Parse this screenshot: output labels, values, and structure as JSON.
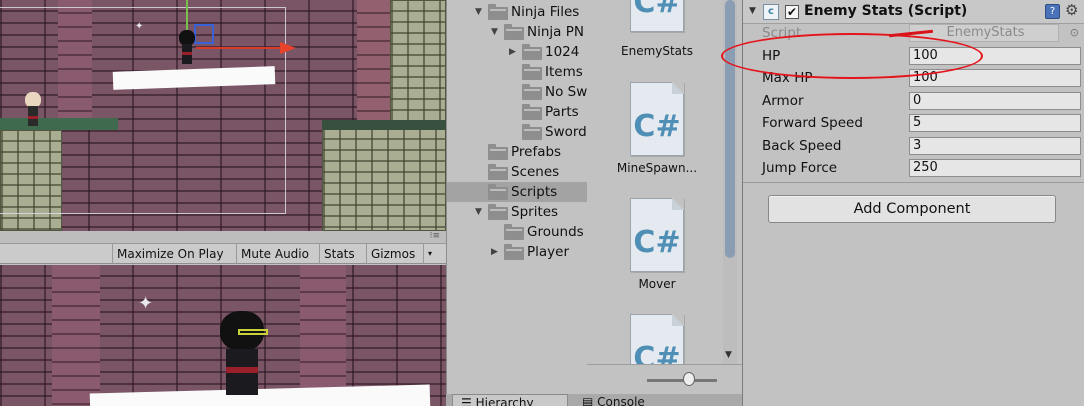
{
  "scene_view": {},
  "game_view": {
    "toolbar": {
      "maximize_label": "Maximize On Play",
      "mute_label": "Mute Audio",
      "stats_label": "Stats",
      "gizmos_label": "Gizmos"
    }
  },
  "project": {
    "tree": [
      {
        "label": "Ninja Files",
        "depth": 1,
        "expanded": true
      },
      {
        "label": "Ninja PN",
        "depth": 2,
        "expanded": true
      },
      {
        "label": "1024",
        "depth": 3,
        "expanded": false
      },
      {
        "label": "Items",
        "depth": 4
      },
      {
        "label": "No Sw",
        "depth": 4
      },
      {
        "label": "Parts",
        "depth": 4
      },
      {
        "label": "Sword",
        "depth": 4
      },
      {
        "label": "Prefabs",
        "depth": 1
      },
      {
        "label": "Scenes",
        "depth": 1
      },
      {
        "label": "Scripts",
        "depth": 1,
        "selected": true
      },
      {
        "label": "Sprites",
        "depth": 1,
        "expanded": true
      },
      {
        "label": "Grounds",
        "depth": 2
      },
      {
        "label": "Player",
        "depth": 2,
        "expanded": false
      }
    ],
    "assets": [
      {
        "name": "EnemyStats",
        "icon": "csharp-script-icon"
      },
      {
        "name": "MineSpawn...",
        "icon": "csharp-script-icon"
      },
      {
        "name": "Mover",
        "icon": "csharp-script-icon"
      },
      {
        "name": "",
        "icon": "csharp-script-icon"
      }
    ],
    "script_glyph": "C#",
    "bottom_tabs": {
      "hierarchy": "Hierarchy",
      "console": "Console"
    }
  },
  "inspector": {
    "component_title": "Enemy Stats (Script)",
    "enabled_mark": "✔",
    "fields": [
      {
        "label": "Script",
        "value": "EnemyStats"
      },
      {
        "label": "HP",
        "value": "100"
      },
      {
        "label": "Max HP",
        "value": "100"
      },
      {
        "label": "Armor",
        "value": "0"
      },
      {
        "label": "Forward Speed",
        "value": "5"
      },
      {
        "label": "Back Speed",
        "value": "3"
      },
      {
        "label": "Jump Force",
        "value": "250"
      }
    ],
    "add_component_label": "Add Component",
    "highlight_color": "#e5141a"
  },
  "colors": {
    "panel_bg": "#c2c2c2",
    "selected_row": "#a3a3a3",
    "scrollbar_thumb": "#8b9db3",
    "csharp_icon": "#4f8fb5"
  }
}
